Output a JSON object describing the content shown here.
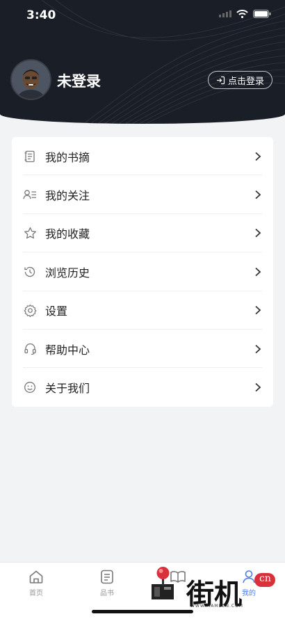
{
  "status_bar": {
    "time": "3:40"
  },
  "profile": {
    "username": "未登录",
    "login_button": "点击登录"
  },
  "menu": {
    "items": [
      {
        "label": "我的书摘",
        "icon": "book-excerpt-icon"
      },
      {
        "label": "我的关注",
        "icon": "follow-icon"
      },
      {
        "label": "我的收藏",
        "icon": "star-icon"
      },
      {
        "label": "浏览历史",
        "icon": "history-icon"
      },
      {
        "label": "设置",
        "icon": "gear-icon"
      },
      {
        "label": "帮助中心",
        "icon": "headset-icon"
      },
      {
        "label": "关于我们",
        "icon": "smiley-icon"
      }
    ]
  },
  "tabbar": {
    "tabs": [
      {
        "label": "首页",
        "icon": "home-icon"
      },
      {
        "label": "品书",
        "icon": "list-book-icon"
      },
      {
        "label": "",
        "icon": "open-book-icon"
      },
      {
        "label": "我的",
        "icon": "user-icon"
      }
    ]
  },
  "watermark": {
    "text": "街机",
    "badge": "cn",
    "url": "WWW.MAMECN.COM"
  }
}
